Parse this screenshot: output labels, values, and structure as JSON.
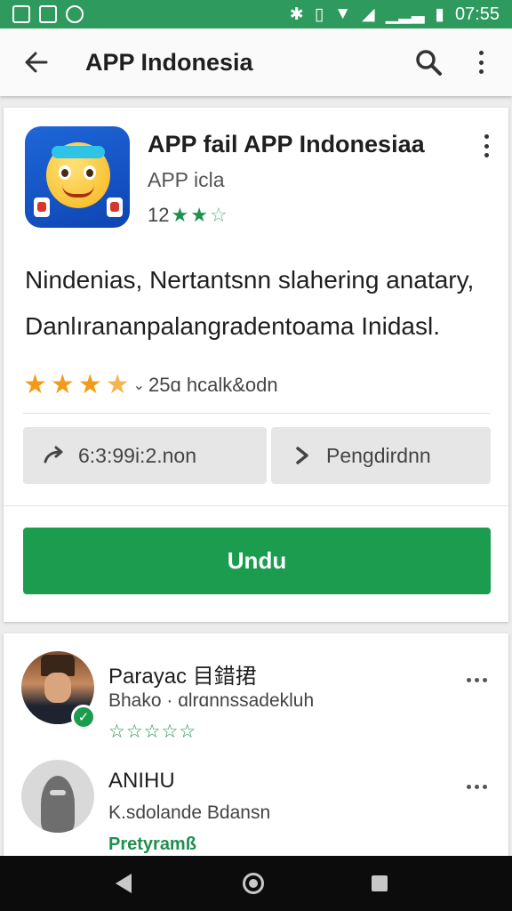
{
  "status_bar": {
    "time": "07:55"
  },
  "app_bar": {
    "title": "APP Indonesia"
  },
  "app": {
    "name": "APP fail APP Indonesiaa",
    "developer": "APP icla",
    "rating_count": "12",
    "description_line1": "Nindenias, Nertantsnn slahering anatary,",
    "description_line2": "Danlıranаnpalangradentoama Inidasl.",
    "reviews_label": "25ɑ hcalk&odn",
    "share_label": "6:3:99i:2.non",
    "next_label": "Pengdirdnn",
    "install_label": "Undu"
  },
  "reviews": [
    {
      "name": "Parayac 目錯捃",
      "subtitle": "Bhako · ɑlrɑnnssadekluh",
      "rating_text": "☆☆☆☆☆"
    },
    {
      "name": "ANIHU",
      "subtitle": "K.sdolande Bdansn",
      "tag": "Pretyramß"
    }
  ],
  "colors": {
    "status_bar": "#2e9a5d",
    "accent_green": "#1b9c4f",
    "star_orange": "#f29b1a"
  }
}
